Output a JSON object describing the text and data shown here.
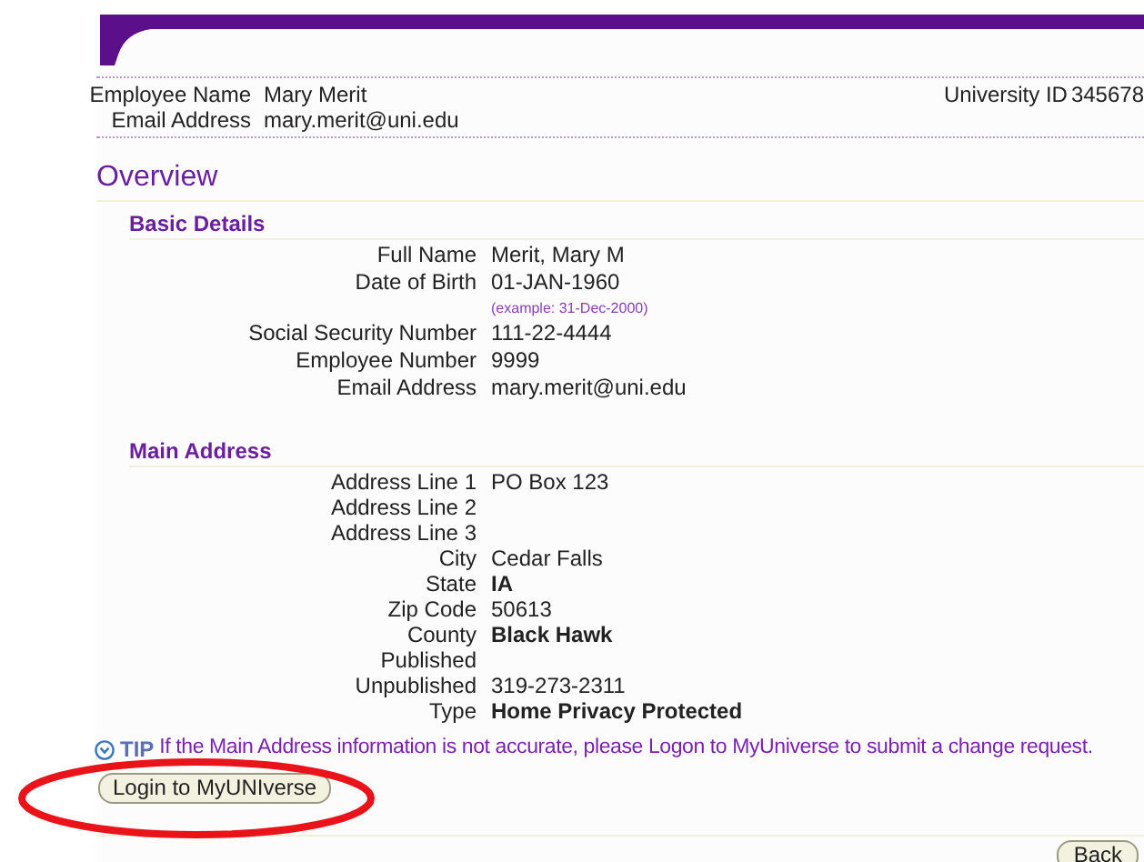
{
  "employee": {
    "name_label": "Employee Name",
    "name": "Mary Merit",
    "email_label": "Email Address",
    "email": "mary.merit@uni.edu",
    "id_label": "University ID",
    "id": "345678"
  },
  "title": "Overview",
  "sections": [
    {
      "heading": "Basic Details",
      "rows": [
        {
          "label": "Full Name",
          "value": "Merit, Mary M",
          "bold": false
        },
        {
          "label": "Date of Birth",
          "value": "01-JAN-1960",
          "bold": false,
          "hint": "(example: 31-Dec-2000)"
        },
        {
          "label": "Social Security Number",
          "value": "111-22-4444",
          "bold": false
        },
        {
          "label": "Employee Number",
          "value": "9999",
          "bold": false
        },
        {
          "label": "Email Address",
          "value": "mary.merit@uni.edu",
          "bold": false
        }
      ]
    },
    {
      "heading": "Main Address",
      "rows": [
        {
          "label": "Address Line 1",
          "value": "PO Box 123",
          "bold": false
        },
        {
          "label": "Address Line 2"
        },
        {
          "label": "Address Line 3"
        },
        {
          "label": "City",
          "value": "Cedar Falls",
          "bold": false
        },
        {
          "label": "State",
          "value": "IA",
          "bold": true
        },
        {
          "label": "Zip Code",
          "value": "50613",
          "bold": false
        },
        {
          "label": "County",
          "value": "Black Hawk",
          "bold": true
        },
        {
          "label": "Published"
        },
        {
          "label": "Unpublished",
          "value": "319-273-2311",
          "bold": false
        },
        {
          "label": "Type",
          "value": "Home Privacy Protected",
          "bold": true
        }
      ]
    }
  ],
  "tip": {
    "label": "TIP",
    "text": "If the Main Address information is not accurate, please Logon to MyUniverse to submit a change request."
  },
  "login_button": "Login to MyUNIverse",
  "back_button": "Back"
}
